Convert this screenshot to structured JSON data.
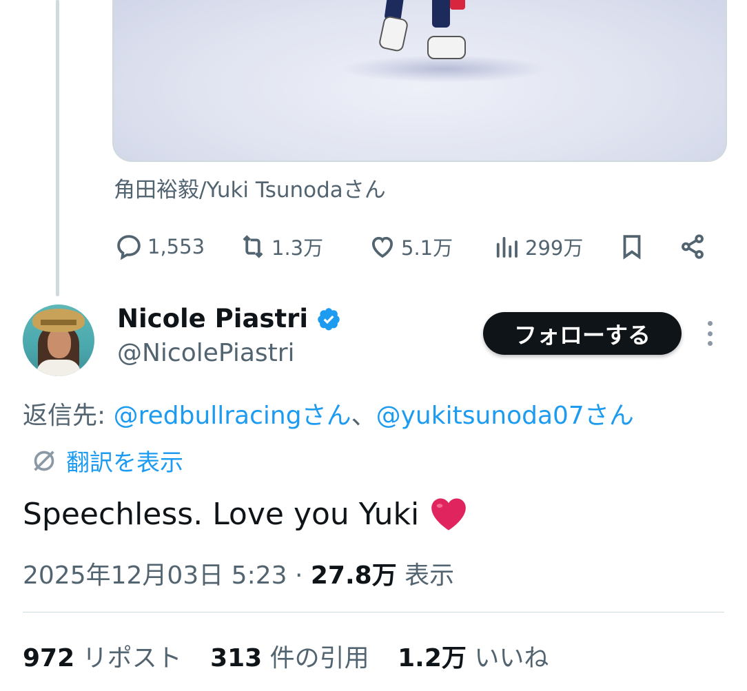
{
  "quoted_tweet": {
    "source_label": "角田裕毅/Yuki Tsunodaさん",
    "actions": {
      "replies": "1,553",
      "reposts": "1.3万",
      "likes": "5.1万",
      "views": "299万"
    }
  },
  "reply": {
    "author_name": "Nicole Piastri",
    "handle": "@NicolePiastri",
    "follow_label": "フォローする",
    "reply_to_prefix": "返信先: ",
    "reply_to_mention_1": "@redbullracingさん",
    "reply_to_separator": "、",
    "reply_to_mention_2": "@yukitsunoda07さん",
    "translate_label": "翻訳を表示",
    "text": "Speechless. Love you Yuki",
    "timestamp": "2025年12月03日 5:23",
    "meta_separator": " · ",
    "views_count": "27.8万",
    "views_label": " 表示",
    "stats": {
      "reposts_count": "972",
      "reposts_label": " リポスト",
      "quotes_count": "313",
      "quotes_label": " 件の引用",
      "likes_count": "1.2万",
      "likes_label": " いいね"
    }
  },
  "colors": {
    "accent": "#1d9bf0",
    "text_primary": "#0f1419",
    "text_secondary": "#536471",
    "border": "#cfd9de",
    "heart": "#e0245e"
  }
}
